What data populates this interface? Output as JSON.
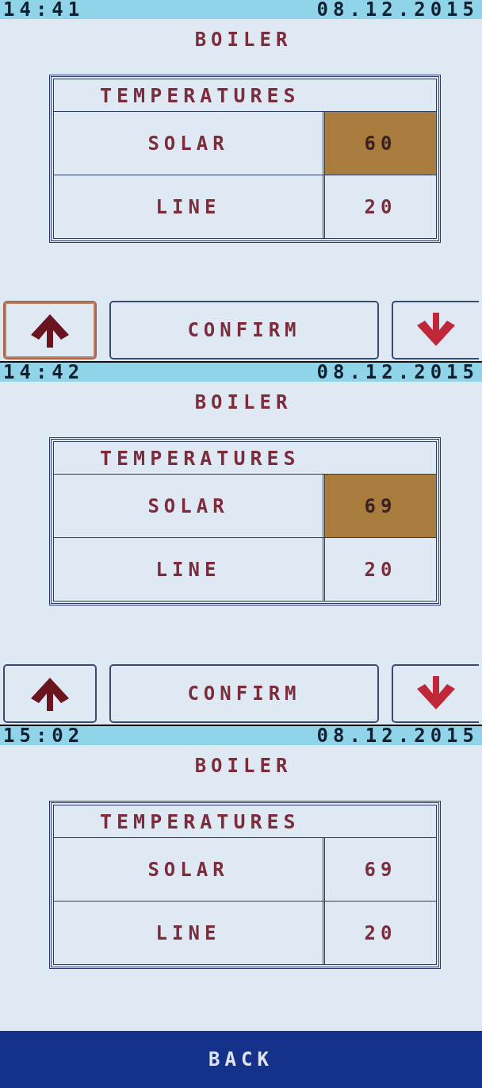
{
  "screens": [
    {
      "status_bar": {
        "time": "14:41",
        "date": "08.12.2015"
      },
      "title": "BOILER",
      "table": {
        "heading": "TEMPERATURES",
        "rows": [
          {
            "label": "SOLAR",
            "value": "60",
            "selected": true
          },
          {
            "label": "LINE",
            "value": "20",
            "selected": false
          }
        ]
      },
      "buttons": [
        {
          "kind": "up",
          "pressed": true
        },
        {
          "kind": "confirm",
          "label": "CONFIRM",
          "pressed": false
        },
        {
          "kind": "down",
          "pressed": false
        }
      ]
    },
    {
      "status_bar": {
        "time": "14:42",
        "date": "08.12.2015"
      },
      "title": "BOILER",
      "table": {
        "heading": "TEMPERATURES",
        "rows": [
          {
            "label": "SOLAR",
            "value": "69",
            "selected": true
          },
          {
            "label": "LINE",
            "value": "20",
            "selected": false
          }
        ]
      },
      "buttons": [
        {
          "kind": "up",
          "pressed": false
        },
        {
          "kind": "confirm",
          "label": "CONFIRM",
          "pressed": false
        },
        {
          "kind": "down",
          "pressed": false
        }
      ]
    },
    {
      "status_bar": {
        "time": "15:02",
        "date": "08.12.2015"
      },
      "title": "BOILER",
      "table": {
        "heading": "TEMPERATURES",
        "rows": [
          {
            "label": "SOLAR",
            "value": "69",
            "selected": false
          },
          {
            "label": "LINE",
            "value": "20",
            "selected": false
          }
        ]
      },
      "buttons": [
        {
          "kind": "back",
          "label": "BACK",
          "pressed": false
        }
      ]
    }
  ]
}
